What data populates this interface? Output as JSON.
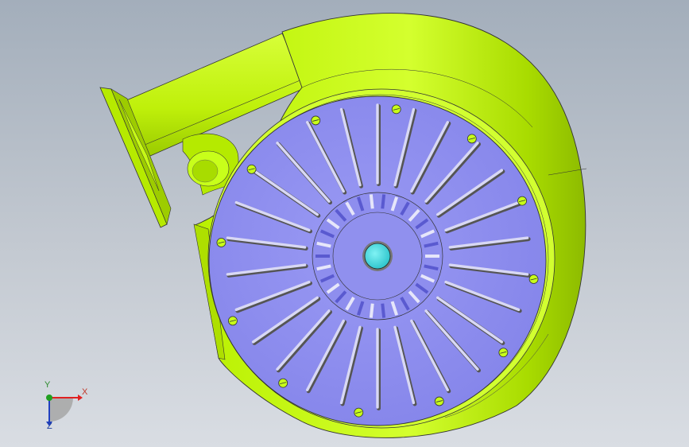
{
  "viewport": {
    "background_top": "#a3aebb",
    "background_bottom": "#d9dde3"
  },
  "model": {
    "housing_color": "#c8ff1a",
    "housing_shadow": "#7fa600",
    "impeller_color": "#8e8ef0",
    "blade_color": "#d8d8f4",
    "hub_color": "#3fd9dd",
    "blade_count": 26,
    "bolt_hole_count": 12
  },
  "triad": {
    "x_label": "X",
    "y_label": "Y",
    "z_label": "Z",
    "x_color": "#e02020",
    "y_color": "#20a020",
    "z_color": "#2040c0"
  }
}
